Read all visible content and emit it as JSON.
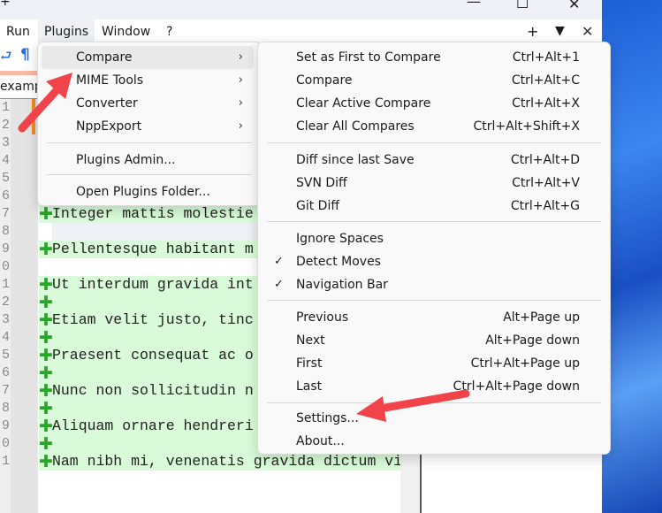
{
  "window": {
    "minimize": "—",
    "maximize": "☐",
    "close": "✕"
  },
  "menubar": [
    "Run",
    "Plugins",
    "Window",
    "?"
  ],
  "menubar_right": {
    "add": "+",
    "dropdown": "▼",
    "close": "✕"
  },
  "toolbar": {
    "wrap_icon": "⮐",
    "pilcrow": "¶"
  },
  "tab": {
    "label": "examp"
  },
  "editor": {
    "line_numbers": [
      "1",
      "2",
      "3",
      "4",
      "5",
      "6",
      "7",
      "8",
      "9",
      "0",
      "1",
      "2",
      "3",
      "4",
      "5",
      "6",
      "7",
      "8",
      "9",
      "0",
      "1"
    ],
    "lines": [
      {
        "n": 7,
        "text": "Integer mattis molestie",
        "added": true
      },
      {
        "n": 8,
        "text": "",
        "added": false
      },
      {
        "n": 9,
        "text": "Pellentesque habitant m",
        "added": true
      },
      {
        "n": 10,
        "text": "",
        "added": false
      },
      {
        "n": 11,
        "text": "Ut interdum gravida int",
        "added": true
      },
      {
        "n": 12,
        "text": "",
        "added": true
      },
      {
        "n": 13,
        "text": "Etiam velit justo, tinc",
        "added": true
      },
      {
        "n": 14,
        "text": "",
        "added": true
      },
      {
        "n": 15,
        "text": "Praesent consequat ac o",
        "added": true
      },
      {
        "n": 16,
        "text": "",
        "added": true
      },
      {
        "n": 17,
        "text": "Nunc non sollicitudin n",
        "added": true
      },
      {
        "n": 18,
        "text": "",
        "added": true
      },
      {
        "n": 19,
        "text": "Aliquam ornare hendreri",
        "added": true
      },
      {
        "n": 20,
        "text": "",
        "added": true
      },
      {
        "n": 21,
        "text": "Nam nibh mi, venenatis gravida dictum vi",
        "added": true
      }
    ],
    "plus_icon": "✚",
    "added_color": "#d9fbd9"
  },
  "plugins_menu": {
    "items": [
      "Compare",
      "MIME Tools",
      "Converter",
      "NppExport",
      "Plugins Admin...",
      "Open Plugins Folder..."
    ],
    "chevron": "›"
  },
  "compare_menu": {
    "items": [
      {
        "label": "Set as First to Compare",
        "shortcut": "Ctrl+Alt+1"
      },
      {
        "label": "Compare",
        "shortcut": "Ctrl+Alt+C"
      },
      {
        "label": "Clear Active Compare",
        "shortcut": "Ctrl+Alt+X"
      },
      {
        "label": "Clear All Compares",
        "shortcut": "Ctrl+Alt+Shift+X"
      },
      {
        "label": "Diff since last Save",
        "shortcut": "Ctrl+Alt+D"
      },
      {
        "label": "SVN Diff",
        "shortcut": "Ctrl+Alt+V"
      },
      {
        "label": "Git Diff",
        "shortcut": "Ctrl+Alt+G"
      },
      {
        "label": "Ignore Spaces",
        "shortcut": ""
      },
      {
        "label": "Detect Moves",
        "shortcut": "",
        "checked": true
      },
      {
        "label": "Navigation Bar",
        "shortcut": "",
        "checked": true
      },
      {
        "label": "Previous",
        "shortcut": "Alt+Page up"
      },
      {
        "label": "Next",
        "shortcut": "Alt+Page down"
      },
      {
        "label": "First",
        "shortcut": "Ctrl+Alt+Page up"
      },
      {
        "label": "Last",
        "shortcut": "Ctrl+Alt+Page down"
      },
      {
        "label": "Settings...",
        "shortcut": ""
      },
      {
        "label": "About...",
        "shortcut": ""
      }
    ],
    "check": "✓"
  },
  "annotation_color": "#f0444a"
}
